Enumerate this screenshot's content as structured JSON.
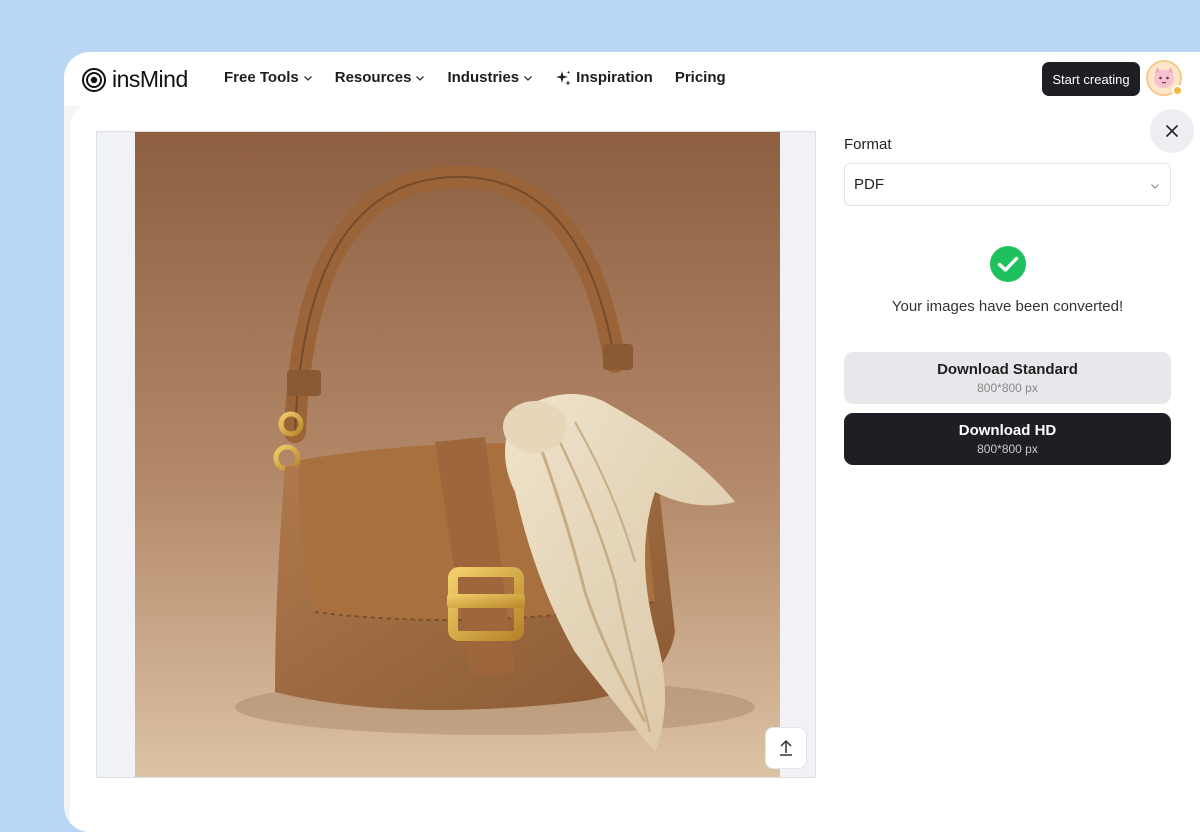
{
  "brand": {
    "name": "insMind"
  },
  "nav": {
    "items": [
      {
        "label": "Free Tools",
        "has_dropdown": true
      },
      {
        "label": "Resources",
        "has_dropdown": true
      },
      {
        "label": "Industries",
        "has_dropdown": true
      },
      {
        "label": "Inspiration",
        "icon": "sparkle-icon"
      },
      {
        "label": "Pricing"
      }
    ],
    "cta_label": "Start creating"
  },
  "dialog": {
    "format_label": "Format",
    "format_value": "PDF",
    "success_message": "Your images have been converted!",
    "download_standard": {
      "title": "Download Standard",
      "size": "800*800 px"
    },
    "download_hd": {
      "title": "Download HD",
      "size": "800*800 px"
    }
  },
  "colors": {
    "page_background": "#b9d6f4",
    "dark_button": "#1e1f24",
    "success_green": "#1fc15f"
  }
}
